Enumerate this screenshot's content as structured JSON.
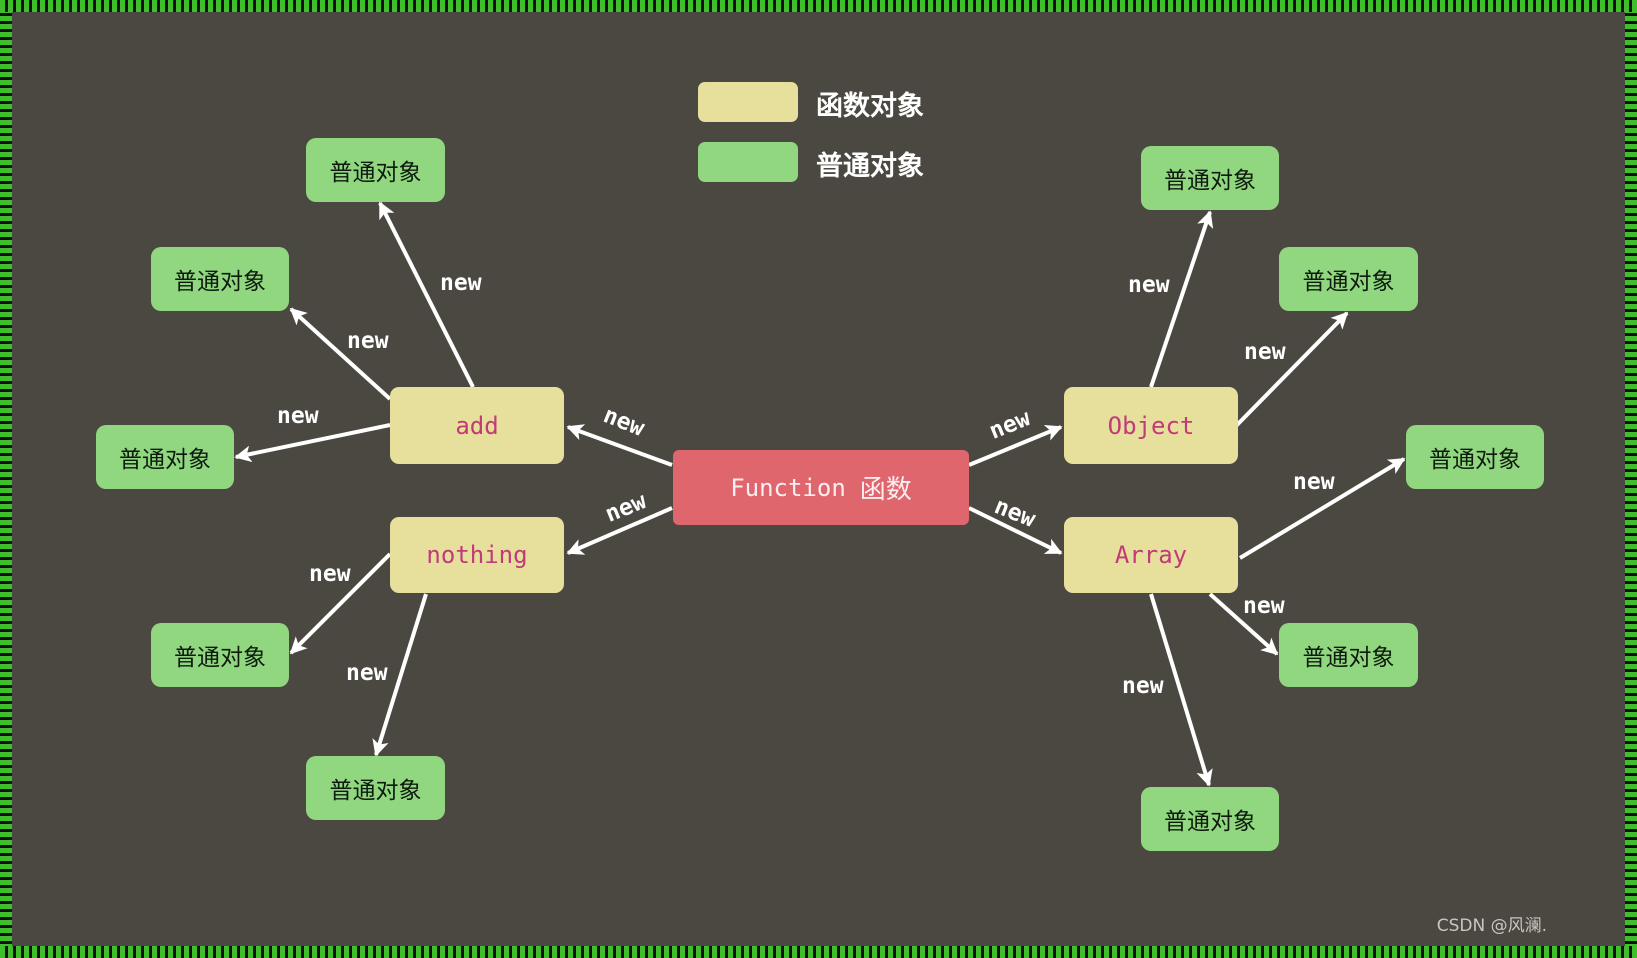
{
  "legend": {
    "function_object_label": "函数对象",
    "plain_object_label": "普通对象",
    "function_object_color": "#e6e09c",
    "plain_object_color": "#90d780"
  },
  "root": {
    "code": "Function",
    "label": "函数"
  },
  "function_nodes": {
    "add": "add",
    "nothing": "nothing",
    "object": "Object",
    "array": "Array"
  },
  "plain_object_label": "普通对象",
  "edge_label": "new",
  "colors": {
    "root": "#e0666e",
    "code_text": "#c23a78",
    "arrow": "#ffffff",
    "background": "#4a4840",
    "border": "#3fbf2a"
  },
  "edges": [
    {
      "from": "Function",
      "to": "add"
    },
    {
      "from": "Function",
      "to": "nothing"
    },
    {
      "from": "Function",
      "to": "Object"
    },
    {
      "from": "Function",
      "to": "Array"
    },
    {
      "from": "add",
      "to": "普通对象"
    },
    {
      "from": "add",
      "to": "普通对象"
    },
    {
      "from": "add",
      "to": "普通对象"
    },
    {
      "from": "nothing",
      "to": "普通对象"
    },
    {
      "from": "nothing",
      "to": "普通对象"
    },
    {
      "from": "Object",
      "to": "普通对象"
    },
    {
      "from": "Object",
      "to": "普通对象"
    },
    {
      "from": "Array",
      "to": "普通对象"
    },
    {
      "from": "Array",
      "to": "普通对象"
    },
    {
      "from": "Array",
      "to": "普通对象"
    }
  ],
  "watermark": "CSDN @风澜."
}
